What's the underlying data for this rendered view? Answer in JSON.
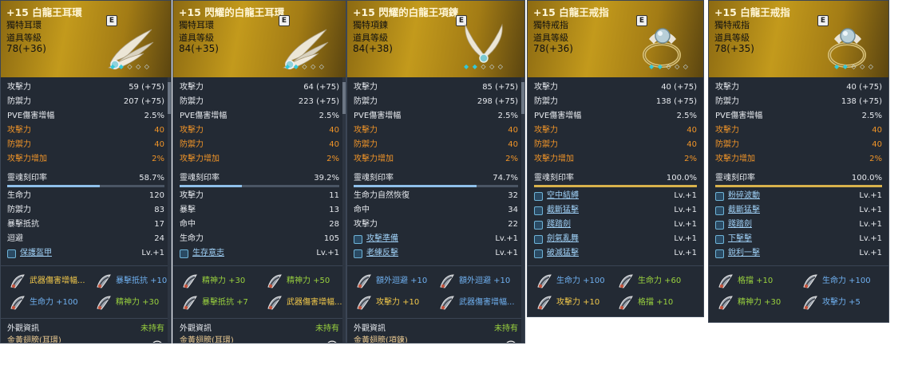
{
  "common": {
    "e_badge": "E",
    "item_level_label": "道具等級",
    "soul_label": "靈魂刻印率",
    "look_title": "外觀資訊",
    "look_state": "未持有"
  },
  "cards": [
    {
      "title": "+15 白龍王耳環",
      "subtype": "獨特耳環",
      "level": "78(+36)",
      "stats": [
        {
          "k": "攻擊力",
          "v": "59 (+75)"
        },
        {
          "k": "防禦力",
          "v": "207 (+75)"
        },
        {
          "k": "PVE傷害增幅",
          "v": "2.5%"
        },
        {
          "k": "攻擊力",
          "v": "40"
        },
        {
          "k": "防禦力",
          "v": "40"
        },
        {
          "k": "攻擊力增加",
          "v": "2%"
        }
      ],
      "soul": "58.7%",
      "soul_fraction": 0.587,
      "substats": [
        {
          "k": "生命力",
          "v": "120"
        },
        {
          "k": "防禦力",
          "v": "83"
        },
        {
          "k": "暴擊抵抗",
          "v": "17"
        },
        {
          "k": "迴避",
          "v": "24"
        }
      ],
      "skills": [
        {
          "k": "保護盔甲",
          "v": "Lv.+1"
        }
      ],
      "gems": [
        {
          "text": "武器傷害增幅...",
          "color": "#f2c84a"
        },
        {
          "text": "暴擊抵抗 +10",
          "color": "#6fb0f0"
        },
        {
          "text": "生命力 +100",
          "color": "#6fb0f0"
        },
        {
          "text": "精神力 +30",
          "color": "#9ad23e"
        }
      ],
      "look_name": "金黃翅膀(耳環)"
    },
    {
      "title": "+15 閃耀的白龍王耳環",
      "subtype": "獨特耳環",
      "level": "84(+35)",
      "stats": [
        {
          "k": "攻擊力",
          "v": "64 (+75)"
        },
        {
          "k": "防禦力",
          "v": "223 (+75)"
        },
        {
          "k": "PVE傷害增幅",
          "v": "2.5%"
        },
        {
          "k": "攻擊力",
          "v": "40"
        },
        {
          "k": "防禦力",
          "v": "40"
        },
        {
          "k": "攻擊力增加",
          "v": "2%"
        }
      ],
      "soul": "39.2%",
      "soul_fraction": 0.392,
      "substats": [
        {
          "k": "攻擊力",
          "v": "11"
        },
        {
          "k": "暴擊",
          "v": "13"
        },
        {
          "k": "命中",
          "v": "28"
        },
        {
          "k": "生命力",
          "v": "105"
        }
      ],
      "skills": [
        {
          "k": "生存意志",
          "v": "Lv.+1"
        }
      ],
      "gems": [
        {
          "text": "精神力 +30",
          "color": "#9ad23e"
        },
        {
          "text": "精神力 +50",
          "color": "#9ad23e"
        },
        {
          "text": "暴擊抵抗 +7",
          "color": "#9ad23e"
        },
        {
          "text": "武器傷害增幅...",
          "color": "#f2c84a"
        }
      ],
      "look_name": "金黃翅膀(耳環)"
    },
    {
      "title": "+15 閃耀的白龍王項鍊",
      "subtype": "獨特項鍊",
      "level": "84(+38)",
      "stats": [
        {
          "k": "攻擊力",
          "v": "85 (+75)"
        },
        {
          "k": "防禦力",
          "v": "298 (+75)"
        },
        {
          "k": "PVE傷害增幅",
          "v": "2.5%"
        },
        {
          "k": "攻擊力",
          "v": "40"
        },
        {
          "k": "防禦力",
          "v": "40"
        },
        {
          "k": "攻擊力增加",
          "v": "2%"
        }
      ],
      "soul": "74.7%",
      "soul_fraction": 0.747,
      "substats": [
        {
          "k": "生命力自然恢復",
          "v": "32"
        },
        {
          "k": "命中",
          "v": "34"
        },
        {
          "k": "攻擊力",
          "v": "22"
        }
      ],
      "skills": [
        {
          "k": "攻擊準備",
          "v": "Lv.+1"
        },
        {
          "k": "老練反擊",
          "v": "Lv.+1"
        }
      ],
      "gems": [
        {
          "text": "額外迴避 +10",
          "color": "#6fb0f0"
        },
        {
          "text": "額外迴避 +10",
          "color": "#6fb0f0"
        },
        {
          "text": "攻擊力 +10",
          "color": "#f2c84a"
        },
        {
          "text": "武器傷害增幅...",
          "color": "#6fb0f0"
        }
      ],
      "look_name": "金黃翅膀(項鍊)"
    },
    {
      "title": "+15 白龍王戒指",
      "subtype": "獨特戒指",
      "level": "78(+36)",
      "stats": [
        {
          "k": "攻擊力",
          "v": "40 (+75)"
        },
        {
          "k": "防禦力",
          "v": "138 (+75)"
        },
        {
          "k": "PVE傷害增幅",
          "v": "2.5%"
        },
        {
          "k": "攻擊力",
          "v": "40"
        },
        {
          "k": "防禦力",
          "v": "40"
        },
        {
          "k": "攻擊力增加",
          "v": "2%"
        }
      ],
      "soul": "100.0%",
      "soul_fraction": 1.0,
      "substats": [],
      "skills": [
        {
          "k": "空中結縛",
          "v": "Lv.+1"
        },
        {
          "k": "截斷猛擊",
          "v": "Lv.+1"
        },
        {
          "k": "踐踏劍",
          "v": "Lv.+1"
        },
        {
          "k": "劍氣亂舞",
          "v": "Lv.+1"
        },
        {
          "k": "破滅猛擊",
          "v": "Lv.+1"
        }
      ],
      "gems": [
        {
          "text": "生命力 +100",
          "color": "#6fb0f0"
        },
        {
          "text": "生命力 +60",
          "color": "#9ad23e"
        },
        {
          "text": "攻擊力 +10",
          "color": "#f2c84a"
        },
        {
          "text": "格擋 +10",
          "color": "#9ad23e"
        }
      ],
      "look_name": ""
    },
    {
      "title": "+15 白龍王戒指",
      "subtype": "獨特戒指",
      "level": "78(+35)",
      "stats": [
        {
          "k": "攻擊力",
          "v": "40 (+75)"
        },
        {
          "k": "防禦力",
          "v": "138 (+75)"
        },
        {
          "k": "PVE傷害增幅",
          "v": "2.5%"
        },
        {
          "k": "攻擊力",
          "v": "40"
        },
        {
          "k": "防禦力",
          "v": "40"
        },
        {
          "k": "攻擊力增加",
          "v": "2%"
        }
      ],
      "soul": "100.0%",
      "soul_fraction": 1.0,
      "substats": [],
      "skills": [
        {
          "k": "粉碎波動",
          "v": "Lv.+1"
        },
        {
          "k": "截斷猛擊",
          "v": "Lv.+1"
        },
        {
          "k": "踐踏劍",
          "v": "Lv.+1"
        },
        {
          "k": "下擊擊",
          "v": "Lv.+1"
        },
        {
          "k": "銳利一擊",
          "v": "Lv.+1"
        }
      ],
      "gems": [
        {
          "text": "格擋 +10",
          "color": "#9ad23e"
        },
        {
          "text": "生命力 +100",
          "color": "#6fb0f0"
        },
        {
          "text": "精神力 +30",
          "color": "#9ad23e"
        },
        {
          "text": "攻擊力 +5",
          "color": "#6fb0f0"
        }
      ],
      "look_name": ""
    }
  ]
}
